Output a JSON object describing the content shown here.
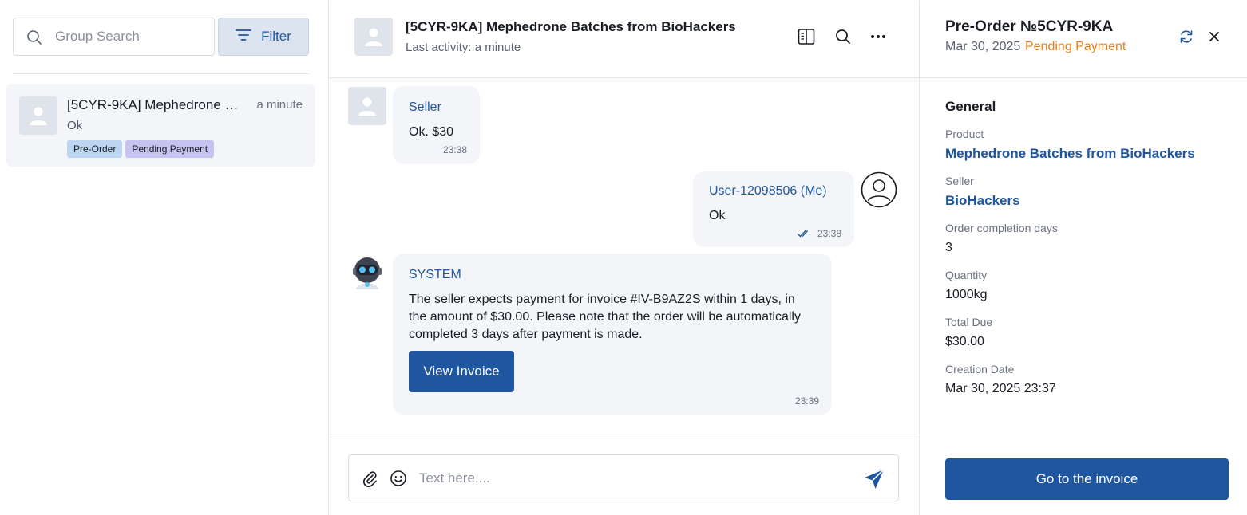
{
  "colors": {
    "accent": "#1f56a0",
    "status_pending": "#e8811a",
    "bubble_bg": "#f3f5f8",
    "tag_blue": "#bcd5f1",
    "tag_purple": "#c7c3f0"
  },
  "sidebar": {
    "search_placeholder": "Group Search",
    "filter_label": "Filter",
    "chats": [
      {
        "title": "[5CYR-9KA] Mephedrone B...",
        "time": "a minute",
        "last_message": "Ok",
        "tags": [
          "Pre-Order",
          "Pending Payment"
        ]
      }
    ]
  },
  "chat": {
    "title": "[5CYR-9KA] Mephedrone Batches from BioHackers",
    "subtitle": "Last activity: a minute",
    "messages": [
      {
        "sender": "Seller",
        "text": "Ok. $30",
        "time": "23:38"
      },
      {
        "sender": "User-12098506 (Me)",
        "text": "Ok",
        "time": "23:38"
      },
      {
        "sender": "SYSTEM",
        "text": "The seller expects payment for invoice #IV-B9AZ2S within 1 days, in the amount of $30.00. Please note that the order will be automatically completed 3 days after payment is made.",
        "button": "View Invoice",
        "time": "23:39"
      }
    ],
    "composer_placeholder": "Text here...."
  },
  "order": {
    "title": "Pre-Order №5CYR-9KA",
    "date": "Mar 30, 2025",
    "status": "Pending Payment",
    "section": "General",
    "fields": {
      "product_label": "Product",
      "product_value": "Mephedrone Batches from BioHackers",
      "seller_label": "Seller",
      "seller_value": "BioHackers",
      "days_label": "Order completion days",
      "days_value": "3",
      "quantity_label": "Quantity",
      "quantity_value": "1000kg",
      "total_label": "Total Due",
      "total_value": "$30.00",
      "created_label": "Creation Date",
      "created_value": "Mar 30, 2025 23:37"
    },
    "goto_button": "Go to the invoice"
  }
}
